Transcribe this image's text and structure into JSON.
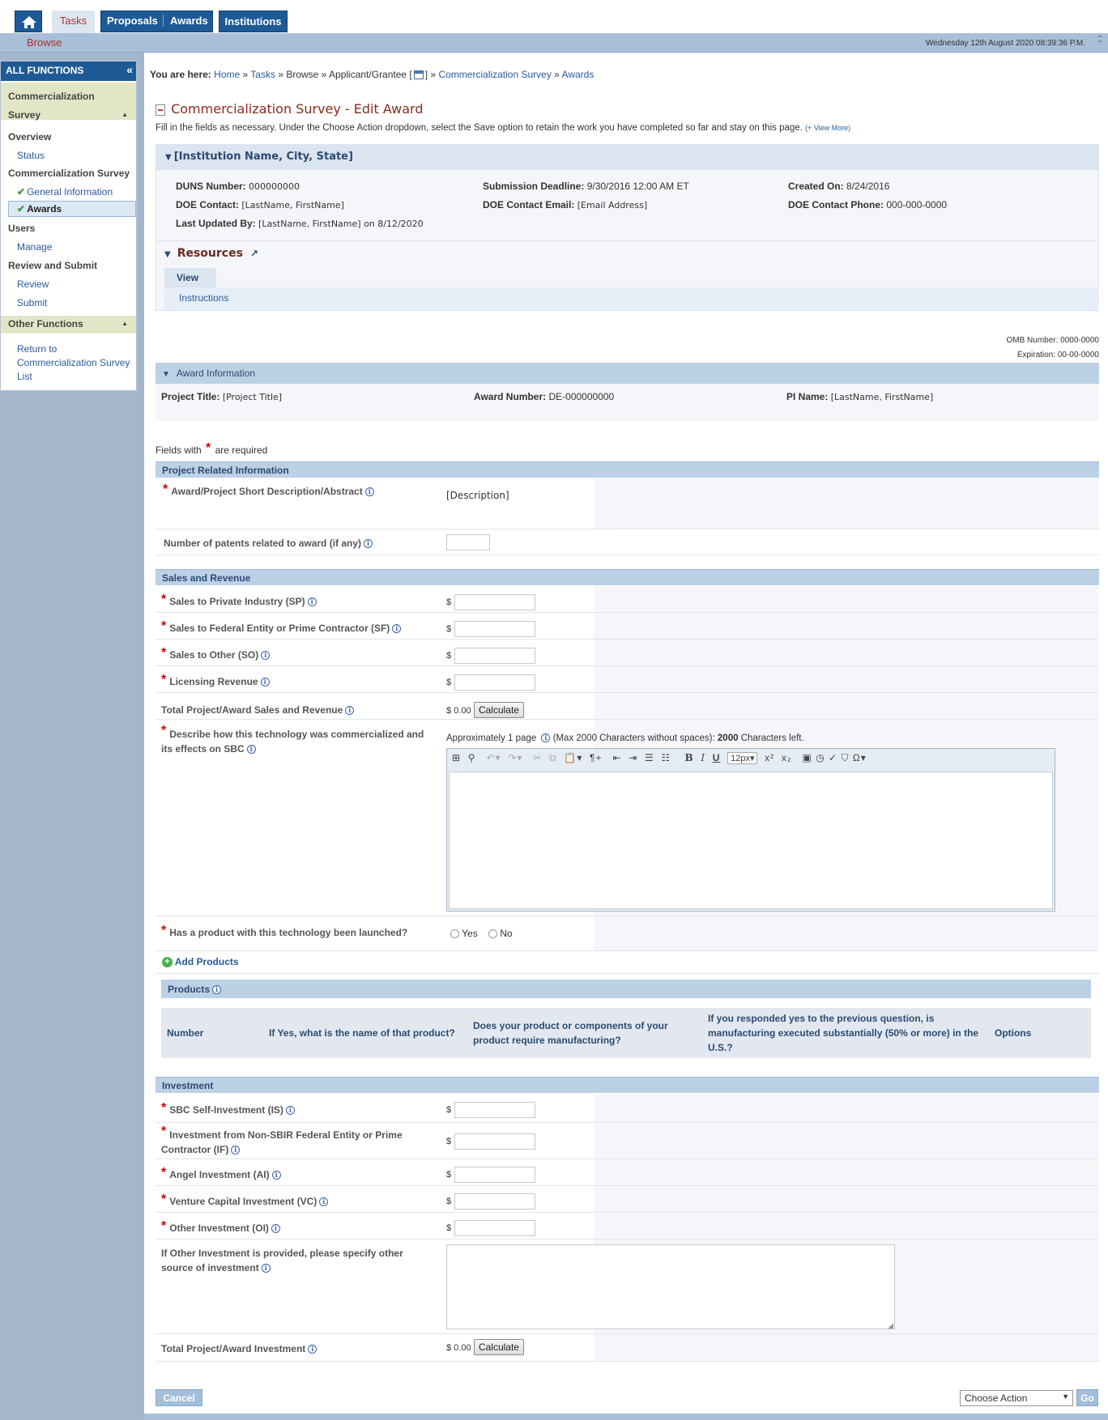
{
  "topnav": {
    "tabs": [
      "Tasks",
      "Proposals",
      "Awards",
      "Institutions"
    ],
    "sub": "Browse",
    "datetime": "Wednesday 12th August 2020 08:39:36 P.M."
  },
  "sidebar": {
    "title": "ALL FUNCTIONS",
    "section1": "Commercialization Survey",
    "items": [
      "Overview",
      "Status",
      "Commercialization Survey",
      "General Information",
      "Awards",
      "Users",
      "Manage",
      "Review and Submit",
      "Review",
      "Submit"
    ],
    "section2": "Other Functions",
    "return": "Return to Commercialization Survey List"
  },
  "breadcrumb": {
    "prefix": "You are here:",
    "home": "Home",
    "tasks": "Tasks",
    "browse": "Browse",
    "applicant": "Applicant/Grantee [",
    "applicant_end": "]",
    "survey": "Commercialization Survey",
    "awards": "Awards"
  },
  "page": {
    "title": "Commercialization Survey - Edit Award",
    "instructions": "Fill in the fields as necessary. Under the Choose Action dropdown, select the Save option to retain the work you have completed so far and stay on this page.",
    "view_more": "(+ View More)"
  },
  "institution": {
    "header": "[Institution Name, City, State]",
    "duns_label": "DUNS Number:",
    "duns": "000000000",
    "deadline_label": "Submission Deadline:",
    "deadline": "9/30/2016 12:00 AM ET",
    "created_label": "Created On:",
    "created": "8/24/2016",
    "contact_label": "DOE Contact:",
    "contact": "[LastName, FirstName]",
    "email_label": "DOE Contact Email:",
    "email": "[Email Address]",
    "phone_label": "DOE Contact Phone:",
    "phone": "000-000-0000",
    "updated_label": "Last Updated By:",
    "updated": "[LastName, FirstName] on 8/12/2020"
  },
  "resources": {
    "title": "Resources",
    "tab": "View",
    "link": "Instructions"
  },
  "omb": {
    "number_label": "OMB Number:",
    "number": "0000-0000",
    "exp_label": "Expiration:",
    "exp": "00-00-0000"
  },
  "award": {
    "header": "Award Information",
    "title_label": "Project Title:",
    "title": "[Project Title]",
    "number_label": "Award Number:",
    "number": "DE-000000000",
    "pi_label": "PI Name:",
    "pi": "[LastName, FirstName]"
  },
  "fields_note": {
    "pre": "Fields with",
    "post": "are required"
  },
  "project": {
    "header": "Project Related Information",
    "abstract_label": "Award/Project Short Description/Abstract",
    "abstract": "[Description]",
    "patents_label": "Number of patents related to award (if any)"
  },
  "sales": {
    "header": "Sales and Revenue",
    "sp": "Sales to Private Industry (SP)",
    "sf": "Sales to Federal Entity or Prime Contractor (SF)",
    "so": "Sales to Other (SO)",
    "lic": "Licensing Revenue",
    "total_label": "Total Project/Award Sales and Revenue",
    "total": "$ 0.00",
    "calc": "Calculate",
    "describe": "Describe how this technology was commercialized and its effects on SBC",
    "approx": "Approximately 1 page",
    "max": "(Max 2000 Characters without spaces):",
    "left_count": "2000",
    "left": "Characters left.",
    "fontsize": "12px"
  },
  "launched": {
    "label": "Has a product with this technology been launched?",
    "yes": "Yes",
    "no": "No"
  },
  "products": {
    "add": "Add Products",
    "header": "Products",
    "cols": [
      "Number",
      "If Yes, what is the name of that product?",
      "Does your product or components of your product require manufacturing?",
      "If you responded yes to the previous question, is manufacturing executed substantially (50% or more) in the U.S.?",
      "Options"
    ]
  },
  "investment": {
    "header": "Investment",
    "is": "SBC Self-Investment (IS)",
    "if": "Investment from Non-SBIR Federal Entity or Prime Contractor (IF)",
    "ai": "Angel Investment (AI)",
    "vc": "Venture Capital Investment (VC)",
    "oi": "Other Investment (OI)",
    "other_src": "If Other Investment is provided, please specify other source of investment",
    "total_label": "Total Project/Award Investment",
    "total": "$ 0.00",
    "calc": "Calculate"
  },
  "footer": {
    "cancel": "Cancel",
    "action": "Choose Action",
    "go": "Go"
  }
}
